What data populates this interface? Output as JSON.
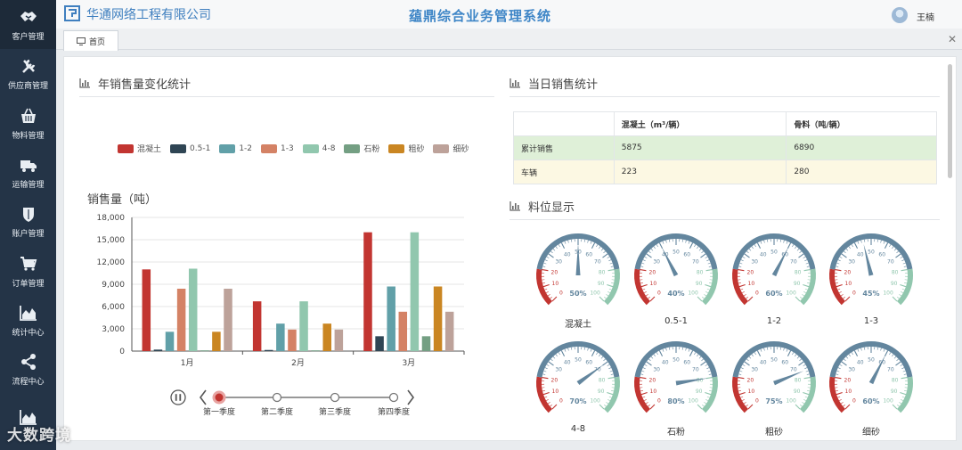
{
  "header": {
    "company": "华通网络工程有限公司",
    "system_title": "蕴鼎综合业务管理系统",
    "user": "王楠"
  },
  "tabs": {
    "home": "首页"
  },
  "sidebar": {
    "items": [
      {
        "label": "客户管理",
        "icon": "handshake-icon"
      },
      {
        "label": "供应商管理",
        "icon": "tools-icon"
      },
      {
        "label": "物料管理",
        "icon": "basket-icon"
      },
      {
        "label": "运输管理",
        "icon": "truck-icon"
      },
      {
        "label": "账户管理",
        "icon": "shield-icon"
      },
      {
        "label": "订单管理",
        "icon": "cart-icon"
      },
      {
        "label": "统计中心",
        "icon": "area-chart-icon"
      },
      {
        "label": "流程中心",
        "icon": "share-icon"
      },
      {
        "label": "",
        "icon": "area-chart-icon"
      }
    ]
  },
  "sections": {
    "annual": "年销售量变化统计",
    "daily": "当日销售统计",
    "bin": "料位显示"
  },
  "chart_data": {
    "type": "bar",
    "ylabel": "销售量（吨）",
    "ylim": [
      0,
      18000
    ],
    "yticks": [
      "0",
      "3,000",
      "6,000",
      "9,000",
      "12,000",
      "15,000",
      "18,000"
    ],
    "categories": [
      "1月",
      "2月",
      "3月"
    ],
    "series": [
      {
        "name": "混凝土",
        "color": "#c23531",
        "values": [
          11000,
          6700,
          16000
        ]
      },
      {
        "name": "0.5-1",
        "color": "#2f4554",
        "values": [
          200,
          150,
          2000
        ]
      },
      {
        "name": "1-2",
        "color": "#61a0a8",
        "values": [
          2600,
          3700,
          8700
        ]
      },
      {
        "name": "1-3",
        "color": "#d48265",
        "values": [
          8400,
          2900,
          5300
        ]
      },
      {
        "name": "4-8",
        "color": "#91c7ae",
        "values": [
          11100,
          6700,
          16000
        ]
      },
      {
        "name": "石粉",
        "color": "#749f83",
        "values": [
          100,
          100,
          2000
        ]
      },
      {
        "name": "粗砂",
        "color": "#ca8622",
        "values": [
          2600,
          3700,
          8700
        ]
      },
      {
        "name": "细砂",
        "color": "#bda29a",
        "values": [
          8400,
          2900,
          5300
        ]
      }
    ]
  },
  "timeline": {
    "items": [
      "第一季度",
      "第二季度",
      "第三季度",
      "第四季度"
    ],
    "active": 0
  },
  "daily_table": {
    "headers": [
      "",
      "混凝土（m³/辆）",
      "骨料（吨/辆）"
    ],
    "rows": [
      [
        "累计销售",
        "5875",
        "6890"
      ],
      [
        "车辆",
        "223",
        "280"
      ]
    ]
  },
  "gauges": [
    {
      "name": "混凝土",
      "value": 50,
      "label": "50%"
    },
    {
      "name": "0.5-1",
      "value": 40,
      "label": "40%"
    },
    {
      "name": "1-2",
      "value": 60,
      "label": "60%"
    },
    {
      "name": "1-3",
      "value": 45,
      "label": "45%"
    },
    {
      "name": "4-8",
      "value": 70,
      "label": "70%"
    },
    {
      "name": "石粉",
      "value": 80,
      "label": "80%"
    },
    {
      "name": "粗砂",
      "value": 75,
      "label": "75%"
    },
    {
      "name": "细砂",
      "value": 60,
      "label": "60%"
    }
  ],
  "gauge_ticks": [
    "0",
    "10",
    "20",
    "30",
    "40",
    "50",
    "60",
    "70",
    "80",
    "90",
    "100"
  ],
  "watermark": "大数跨境"
}
